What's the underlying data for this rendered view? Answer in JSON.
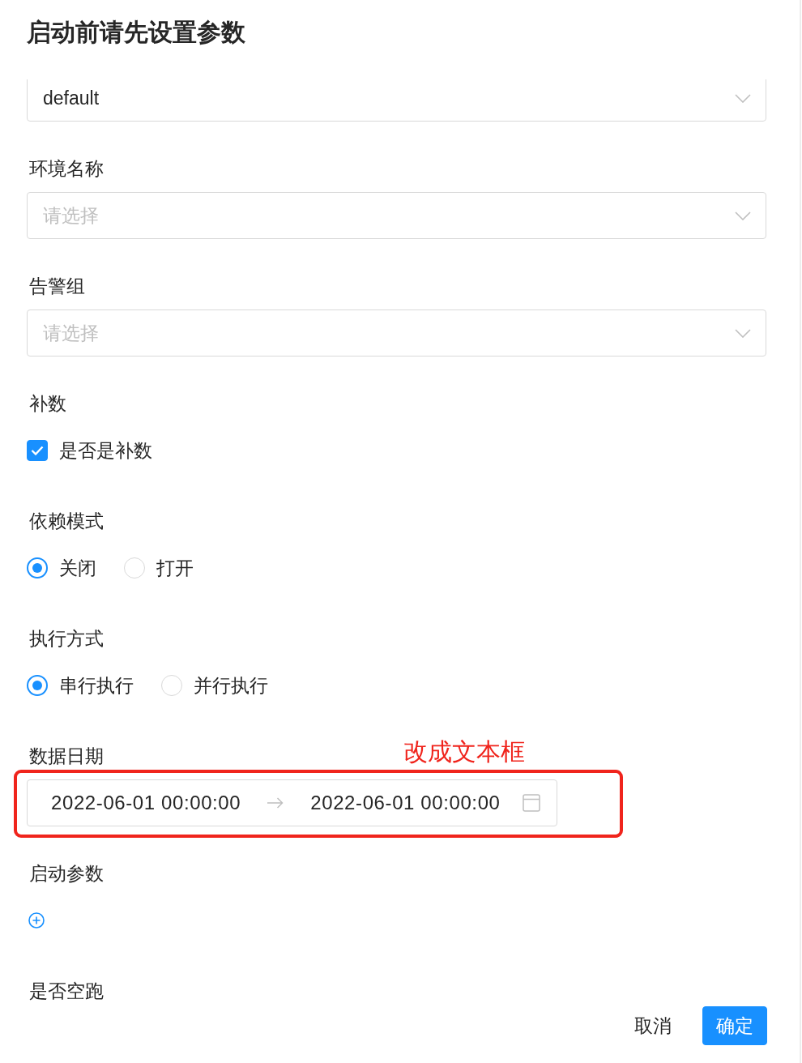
{
  "dialog": {
    "title": "启动前请先设置参数"
  },
  "fields": [
    {
      "kind": "select",
      "clipped": true,
      "value": "default"
    },
    {
      "kind": "select",
      "label": "环境名称",
      "placeholder": "请选择"
    },
    {
      "kind": "select",
      "label": "告警组",
      "placeholder": "请选择"
    },
    {
      "kind": "checkbox",
      "label": "补数",
      "option": "是否是补数",
      "checked": true
    },
    {
      "kind": "radio",
      "label": "依赖模式",
      "options": [
        {
          "label": "关闭",
          "selected": true
        },
        {
          "label": "打开",
          "selected": false
        }
      ]
    },
    {
      "kind": "radio",
      "label": "执行方式",
      "options": [
        {
          "label": "串行执行",
          "selected": true
        },
        {
          "label": "并行执行",
          "selected": false
        }
      ]
    },
    {
      "kind": "date_range",
      "label": "数据日期",
      "start": "2022-06-01 00:00:00",
      "end": "2022-06-01 00:00:00",
      "annotation": "改成文本框"
    },
    {
      "kind": "add",
      "label": "启动参数"
    },
    {
      "kind": "label_only",
      "label": "是否空跑"
    }
  ],
  "footer": {
    "buttons": [
      {
        "kind": "text",
        "label": "取消"
      },
      {
        "kind": "primary",
        "label": "确定"
      }
    ]
  }
}
